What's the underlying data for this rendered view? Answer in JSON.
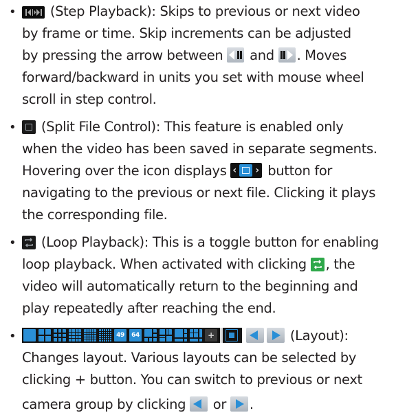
{
  "items": [
    {
      "lines": [
        {
          "pre": "",
          "post": " (Step Playback): Skips to previous or next video"
        },
        {
          "text": "by frame or time. Skip increments can be adjusted"
        },
        {
          "pre": "by pressing the arrow between ",
          "mid": " and ",
          "post": ". Moves"
        },
        {
          "text": "forward/backward in units you set with mouse wheel"
        },
        {
          "text": "scroll in step control."
        }
      ]
    },
    {
      "lines": [
        {
          "post": " (Split File Control): This feature is enabled only"
        },
        {
          "text": "when the video has been saved in separate segments."
        },
        {
          "pre": "Hovering over the icon displays ",
          "post": " button for"
        },
        {
          "text": "navigating to the previous or next file. Clicking it plays"
        },
        {
          "text": "the corresponding file."
        }
      ]
    },
    {
      "lines": [
        {
          "post": " (Loop Playback): This is a toggle button for enabling"
        },
        {
          "pre": "loop playback. When activated with clicking ",
          "post": ", the"
        },
        {
          "text": "video will automatically return to the beginning and"
        },
        {
          "text": "play repeatedly after reaching the end."
        }
      ]
    },
    {
      "lines": [
        {
          "post": " (Layout):"
        },
        {
          "text": "Changes layout. Various layouts can be selected by"
        },
        {
          "text": "clicking + button. You can switch to previous or next"
        },
        {
          "pre": "camera group by clicking ",
          "mid": " or ",
          "post": "."
        }
      ],
      "layout_labels": {
        "l49": "49",
        "l64": "64",
        "plus": "+"
      }
    }
  ],
  "bullet": "•",
  "colors": {
    "accent": "#2a8fd6",
    "loop_active": "#2ea84a",
    "text": "#231f20"
  },
  "icons": [
    "step-playback-icon",
    "step-back-button-icon",
    "step-forward-button-icon",
    "split-file-icon",
    "split-file-nav-icon",
    "loop-playback-icon",
    "loop-active-icon",
    "layout-strip-icon",
    "prev-group-icon",
    "next-group-icon"
  ]
}
